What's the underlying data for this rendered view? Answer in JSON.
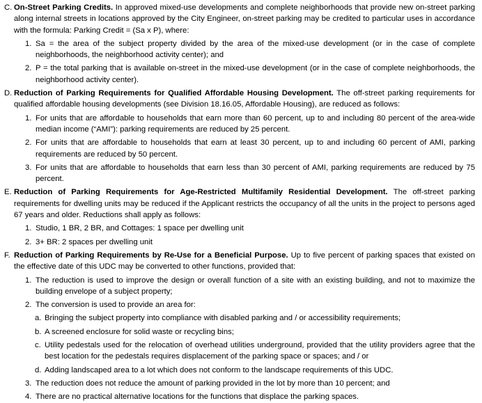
{
  "sections": [
    {
      "label": "C.",
      "title": "On-Street Parking Credits.",
      "text": " In approved mixed-use developments and complete neighborhoods that provide new on-street parking along internal streets in locations approved by the City Engineer, on-street parking may be credited to particular uses in accordance with the formula: Parking Credit = (Sa x P), where:",
      "items": [
        {
          "label": "1.",
          "text": "Sa = the area of the subject property divided by the area of the mixed-use development (or in the case of complete neighborhoods, the neighborhood activity center); and"
        },
        {
          "label": "2.",
          "text": "P = the total parking that is available on-street in the mixed-use development (or in the case of complete neighborhoods, the neighborhood activity center)."
        }
      ]
    },
    {
      "label": "D.",
      "title": "Reduction of Parking Requirements for Qualified Affordable Housing Development.",
      "text": " The off-street parking requirements for qualified affordable housing developments (see Division 18.16.05, Affordable Housing), are reduced as follows:",
      "items": [
        {
          "label": "1.",
          "text": "For units that are affordable to households that earn more than 60 percent, up to and including 80 percent of the area-wide median income (“AMI”): parking requirements are reduced by 25 percent."
        },
        {
          "label": "2.",
          "text": "For units that are affordable to households that earn at least 30 percent, up to and including 60 percent of AMI, parking requirements are reduced by 50 percent."
        },
        {
          "label": "3.",
          "text": "For units that are affordable to households that earn less than 30 percent of AMI, parking requirements are reduced by 75 percent."
        }
      ]
    },
    {
      "label": "E.",
      "title": "Reduction of Parking Requirements for Age-Restricted Multifamily Residential Development.",
      "text": " The off-street parking requirements for dwelling units may be reduced if the Applicant restricts the occupancy of all the units in the project to persons aged 67 years and older. Reductions shall apply as follows:",
      "items": [
        {
          "label": "1.",
          "text": "Studio, 1 BR, 2 BR, and Cottages: 1 space per dwelling unit"
        },
        {
          "label": "2.",
          "text": "3+ BR: 2 spaces per dwelling unit"
        }
      ]
    },
    {
      "label": "F.",
      "title": "Reduction of Parking Requirements by Re-Use for a Beneficial Purpose.",
      "text": " Up to five percent of parking spaces that existed on the effective date of this UDC may be converted to other functions, provided that:",
      "items": [
        {
          "label": "1.",
          "text": "The reduction is used to improve the design or overall function of a site with an existing building, and not to maximize the building envelope of a subject property;"
        },
        {
          "label": "2.",
          "text": "The conversion is used to provide an area for:",
          "subitems": [
            {
              "label": "a.",
              "text": "Bringing the subject property into compliance with disabled parking and / or accessibility requirements;"
            },
            {
              "label": "b.",
              "text": "A screened enclosure for solid waste or recycling bins;"
            },
            {
              "label": "c.",
              "text": "Utility pedestals used for the relocation of overhead utilities underground, provided that the utility providers agree that the best location for the pedestals requires displacement of the parking space or spaces; and / or"
            },
            {
              "label": "d.",
              "text": "Adding landscaped area to a lot which does not conform to the landscape requirements of this UDC."
            }
          ]
        },
        {
          "label": "3.",
          "text": "The reduction does not reduce the amount of parking provided in the lot by more than 10 percent; and"
        },
        {
          "label": "4.",
          "text": "There are no practical alternative locations for the functions that displace the parking spaces."
        }
      ]
    }
  ]
}
